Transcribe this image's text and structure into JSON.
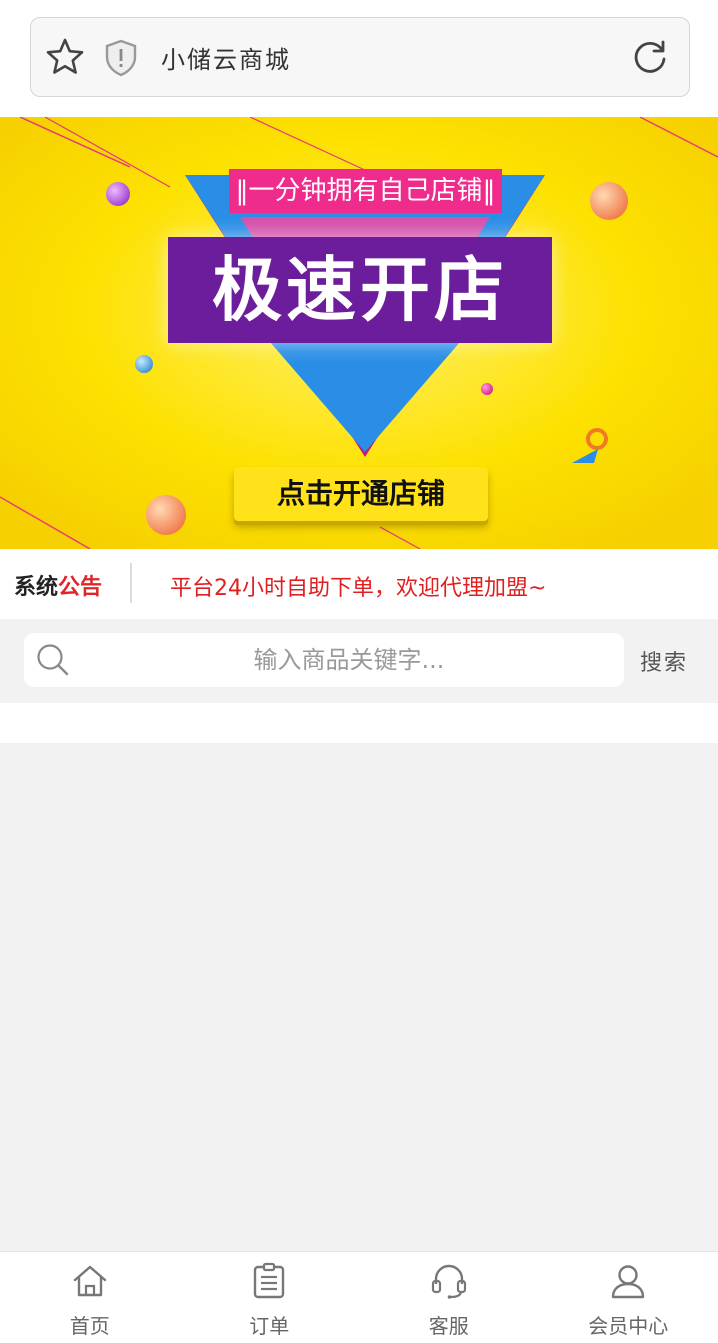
{
  "browser": {
    "title": "小储云商城"
  },
  "banner": {
    "tag": "‖一分钟拥有自己店铺‖",
    "headline": "极速开店",
    "cta": "点击开通店铺"
  },
  "notice": {
    "label_part1": "系统",
    "label_part2": "公告",
    "text": "平台24小时自助下单，欢迎代理加盟~"
  },
  "search": {
    "placeholder": "输入商品关键字...",
    "button_label": "搜索"
  },
  "tabbar": {
    "items": [
      {
        "label": "首页",
        "icon": "home-icon"
      },
      {
        "label": "订单",
        "icon": "order-icon"
      },
      {
        "label": "客服",
        "icon": "headset-icon"
      },
      {
        "label": "会员中心",
        "icon": "user-icon"
      }
    ]
  },
  "colors": {
    "banner_bg": "#fde100",
    "accent_red": "#e02020",
    "headline_purple": "#6b1d9b",
    "tag_pink": "#ef2b8c"
  }
}
